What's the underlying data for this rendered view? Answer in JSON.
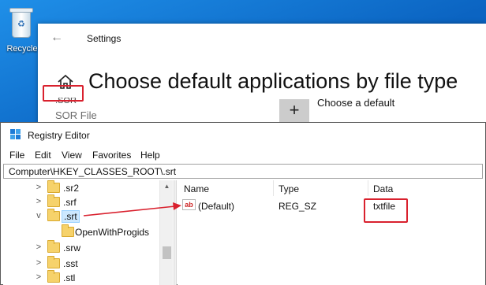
{
  "desktop": {
    "recycle_bin_label": "Recycle"
  },
  "settings": {
    "app_title": "Settings",
    "heading": "Choose default applications by file type",
    "partial_extension": ".SOR",
    "file_type_description": "SOR File",
    "add_button_label": "+",
    "choose_default_label": "Choose a default"
  },
  "registry_editor": {
    "title": "Registry Editor",
    "menu": [
      "File",
      "Edit",
      "View",
      "Favorites",
      "Help"
    ],
    "address": "Computer\\HKEY_CLASSES_ROOT\\.srt",
    "tree": [
      {
        "label": ".sr2",
        "expander": ">",
        "selected": false
      },
      {
        "label": ".srf",
        "expander": ">",
        "selected": false
      },
      {
        "label": ".srt",
        "expander": "v",
        "selected": true
      },
      {
        "label": "OpenWithProgids",
        "expander": "",
        "selected": false
      },
      {
        "label": ".srw",
        "expander": ">",
        "selected": false
      },
      {
        "label": ".sst",
        "expander": ">",
        "selected": false
      },
      {
        "label": ".stl",
        "expander": ">",
        "selected": false
      }
    ],
    "columns": {
      "name": "Name",
      "type": "Type",
      "data": "Data"
    },
    "values": [
      {
        "icon": "ab",
        "name": "(Default)",
        "type": "REG_SZ",
        "data": "txtfile"
      }
    ]
  },
  "colors": {
    "annotation": "#d9212e",
    "desktop_blue": "#0b64c2",
    "selection": "#cce8ff",
    "folder": "#f6d26b"
  }
}
